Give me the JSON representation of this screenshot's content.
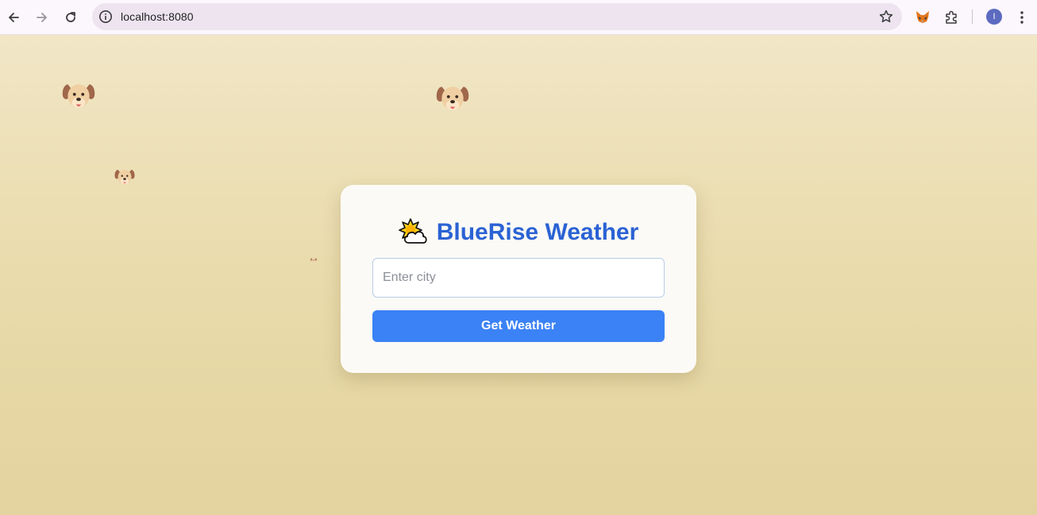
{
  "browser": {
    "url": "localhost:8080",
    "profile_initial": "I",
    "icons": {
      "back": "back-arrow-icon",
      "forward": "forward-arrow-icon",
      "reload": "reload-icon",
      "site_info": "info-icon",
      "bookmark": "star-icon",
      "metamask": "fox-icon",
      "extensions": "puzzle-icon",
      "menu": "kebab-menu-icon"
    }
  },
  "app": {
    "title_icon": "sun-behind-cloud-icon",
    "title": "BlueRise Weather",
    "city_input": {
      "placeholder": "Enter city",
      "value": ""
    },
    "submit_label": "Get Weather"
  },
  "decorations": {
    "icon": "dog-face-icon"
  },
  "colors": {
    "title": "#2b62d4",
    "button": "#3b82f6",
    "background_top": "#f1e6c6",
    "background_bottom": "#e3d39f"
  }
}
